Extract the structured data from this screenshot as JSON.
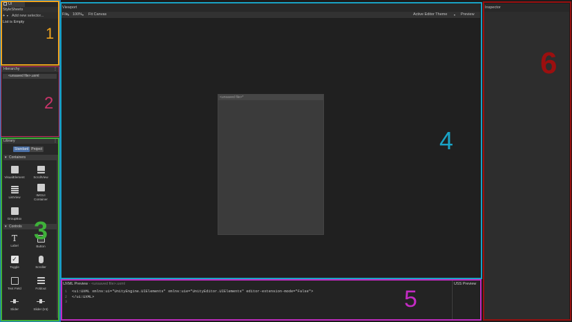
{
  "stylesheets": {
    "window_tab": "UI Builder",
    "title": "StyleSheets",
    "add_button": "+",
    "selector_placeholder": "Add new selector...",
    "empty_text": "List is Empty"
  },
  "hierarchy": {
    "title": "Hierarchy",
    "item": "<unsaved file>.uxml"
  },
  "library": {
    "title": "Library",
    "tabs": [
      "Standard",
      "Project"
    ],
    "sections": {
      "containers": "Containers",
      "controls": "Controls"
    },
    "containers": [
      "VisualElement",
      "ScrollView",
      "ListView",
      "IMGUI Container",
      "GroupBox"
    ],
    "controls": [
      "Label",
      "Button",
      "Toggle",
      "Scroller",
      "Text Field",
      "Foldout",
      "Slider",
      "Slider (Int)"
    ]
  },
  "viewport": {
    "title": "Viewport",
    "file_menu": "File",
    "zoom": "100%",
    "fit_canvas": "Fit Canvas",
    "theme": "Active Editor Theme",
    "preview": "Preview",
    "canvas_title": "<unsaved file>*"
  },
  "uxml_preview": {
    "title": "UXML Preview",
    "subtitle": "- <unsaved file>.uxml",
    "line_numbers": [
      "1",
      "2",
      "3"
    ],
    "lines": [
      "<ui:UXML xmlns:ui=\"UnityEngine.UIElements\" xmlns:uie=\"UnityEditor.UIElements\" editor-extension-mode=\"False\">",
      "</ui:UXML>",
      ""
    ]
  },
  "uss_preview": {
    "title": "USS Preview"
  },
  "inspector": {
    "title": "Inspector"
  },
  "annotations": {
    "n1": "1",
    "n2": "2",
    "n3": "3",
    "n4": "4",
    "n5": "5",
    "n6": "6"
  },
  "colors": {
    "outline_1": "#f2a51e",
    "outline_2": "#c9346a",
    "outline_3": "#3fb13a",
    "outline_4": "#19a3c6",
    "outline_5": "#c42bc4",
    "outline_6": "#9b0f0f",
    "outline_left": "#1e7fc4"
  }
}
